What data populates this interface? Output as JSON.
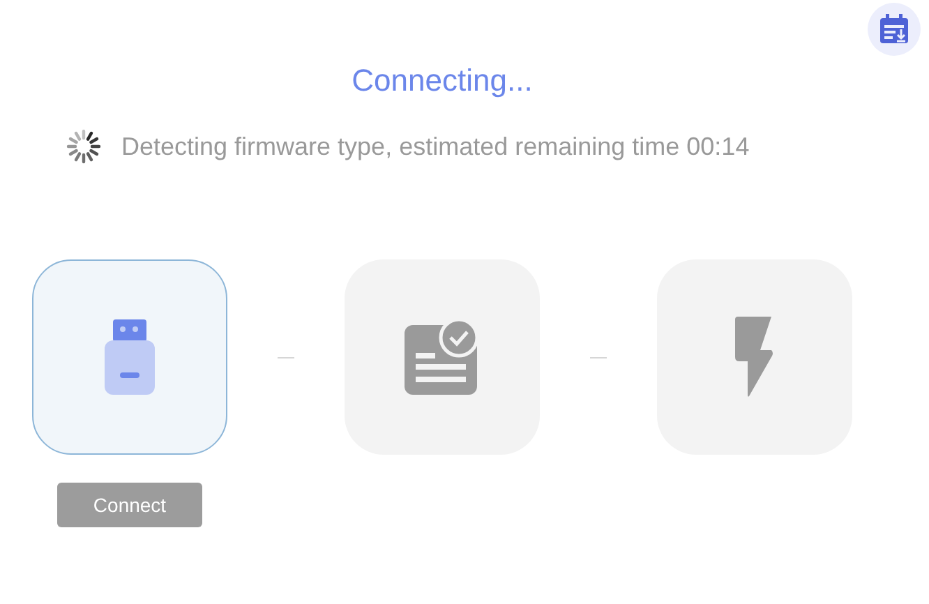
{
  "title": "Connecting...",
  "status": {
    "text": "Detecting firmware type, estimated remaining time 00:14"
  },
  "steps": [
    {
      "kind": "usb",
      "selected": true
    },
    {
      "kind": "firmware",
      "selected": false
    },
    {
      "kind": "flash",
      "selected": false
    }
  ],
  "connect_button": {
    "label": "Connect",
    "disabled": true
  }
}
